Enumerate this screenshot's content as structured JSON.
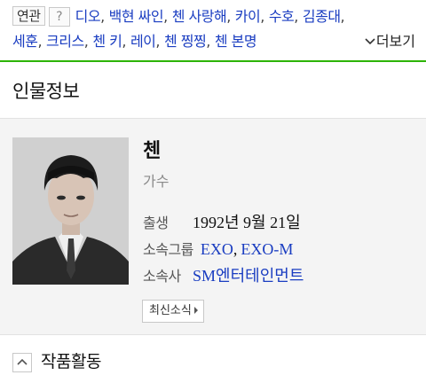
{
  "related": {
    "tag_label": "연관",
    "help_label": "?",
    "line1": [
      "디오",
      "백현 싸인",
      "첸 사랑해",
      "카이",
      "수호",
      "김종대"
    ],
    "line2": [
      "세훈",
      "크리스",
      "첸 키",
      "레이",
      "첸 찡찡",
      "첸 본명"
    ],
    "separator": ",",
    "more_label": "더보기"
  },
  "profile": {
    "section_title": "인물정보",
    "name": "첸",
    "occupation": "가수",
    "birth_label": "출생",
    "birth_value": "1992년 9월 21일",
    "group_label": "소속그룹",
    "groups": [
      "EXO",
      "EXO-M"
    ],
    "agency_label": "소속사",
    "agency_value": "SM엔터테인먼트",
    "news_button": "최신소식"
  },
  "works": {
    "title": "작품활동"
  },
  "colors": {
    "link": "#1a3dc1",
    "accent_green": "#2db400",
    "panel_bg": "#f4f4f4"
  }
}
